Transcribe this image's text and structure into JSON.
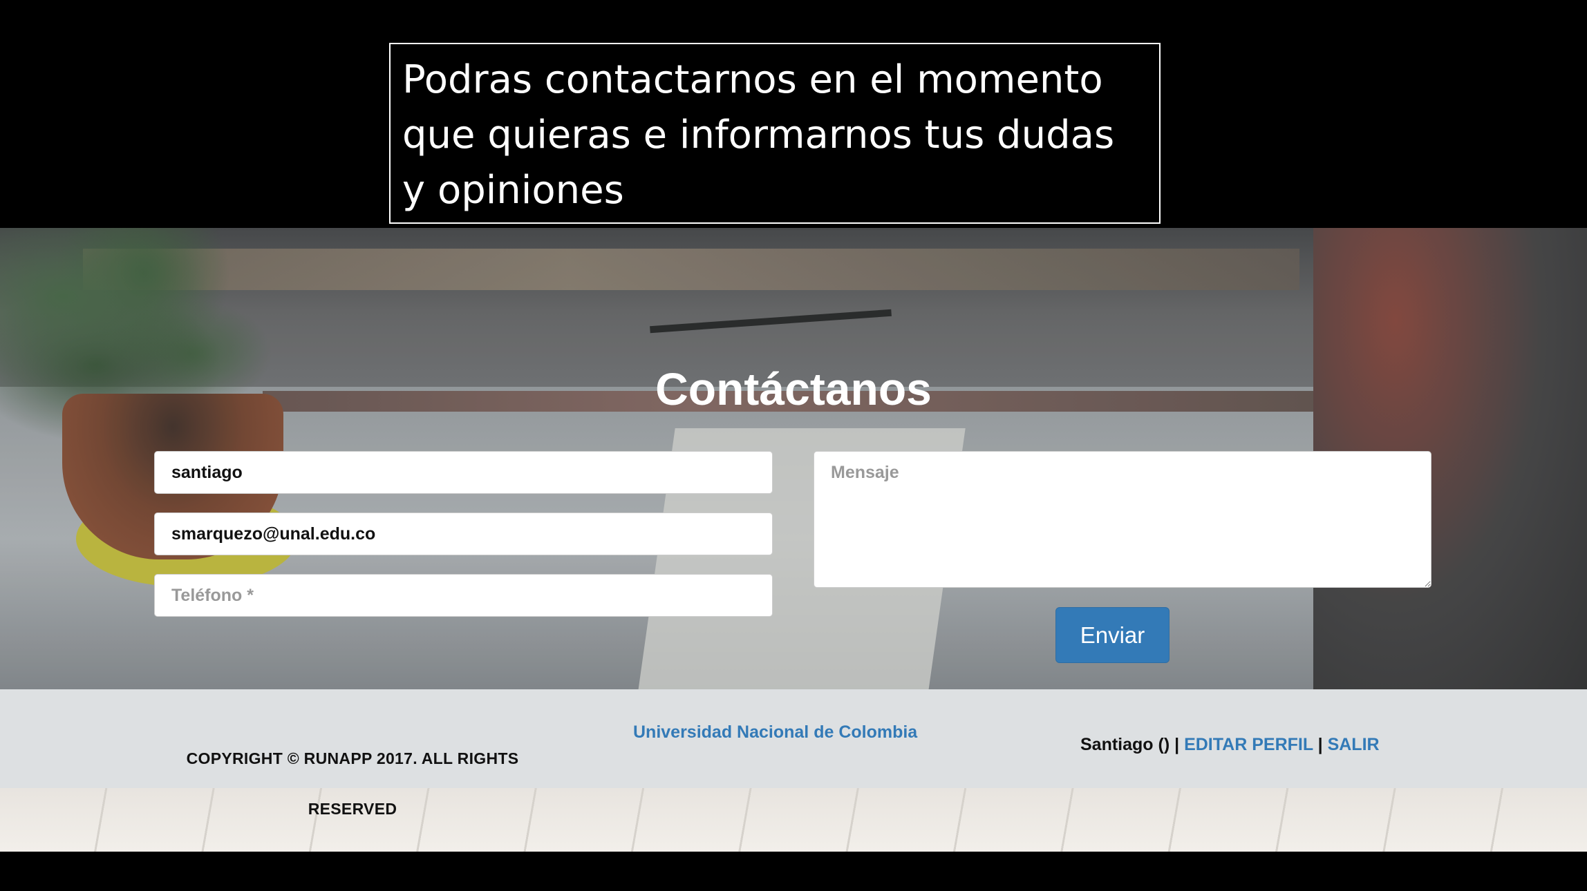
{
  "annotation": {
    "text": "Podras contactarnos en el momento que quieras e informarnos tus dudas y opiniones"
  },
  "contact": {
    "title": "Contáctanos",
    "name_value": "santiago",
    "email_value": "smarquezo@unal.edu.co",
    "phone_placeholder": "Teléfono *",
    "message_placeholder": "Mensaje",
    "send_label": "Enviar"
  },
  "footer": {
    "copyright": "COPYRIGHT © RUNAPP 2017. ALL RIGHTS RESERVED",
    "university_link": "Universidad Nacional de Colombia",
    "user_label": "Santiago ()",
    "separator": "|",
    "edit_profile": "EDITAR PERFIL",
    "logout": "SALIR"
  },
  "colors": {
    "accent": "#337ab7",
    "footer_bg": "#ebeef0"
  }
}
